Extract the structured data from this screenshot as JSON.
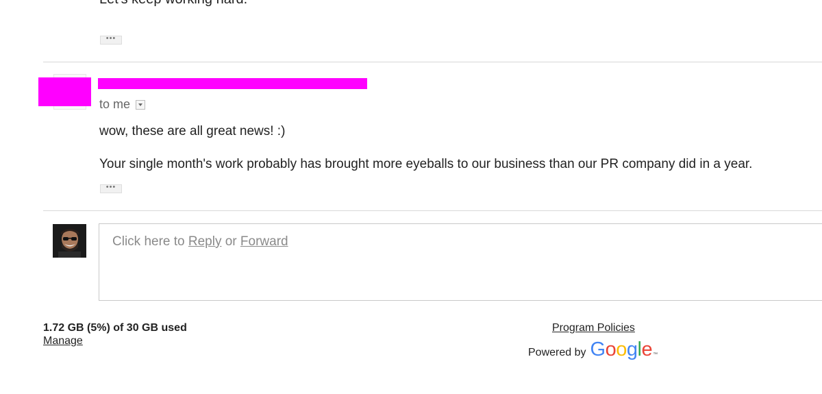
{
  "previous_message": {
    "last_line": "Let's keep working hard."
  },
  "message": {
    "recipient_label": "to me",
    "body": [
      "wow, these are all great news! :)",
      "Your single month's work probably has brought more eyeballs to our business than our PR company did in a year."
    ],
    "show_trimmed_label": "•••"
  },
  "reply": {
    "prompt_prefix": "Click here to ",
    "reply_label": "Reply",
    "or_text": " or ",
    "forward_label": "Forward"
  },
  "footer": {
    "storage_usage": "1.72 GB (5%) of 30 GB used",
    "manage_label": "Manage",
    "program_policies_label": "Program Policies",
    "powered_by_label": "Powered by",
    "google_logo_text": "Google",
    "trademark": "™"
  },
  "colors": {
    "redaction": "#ff00ff",
    "google_blue": "#4285f4",
    "google_red": "#ea4335",
    "google_yellow": "#fbbc05",
    "google_green": "#34a853"
  }
}
